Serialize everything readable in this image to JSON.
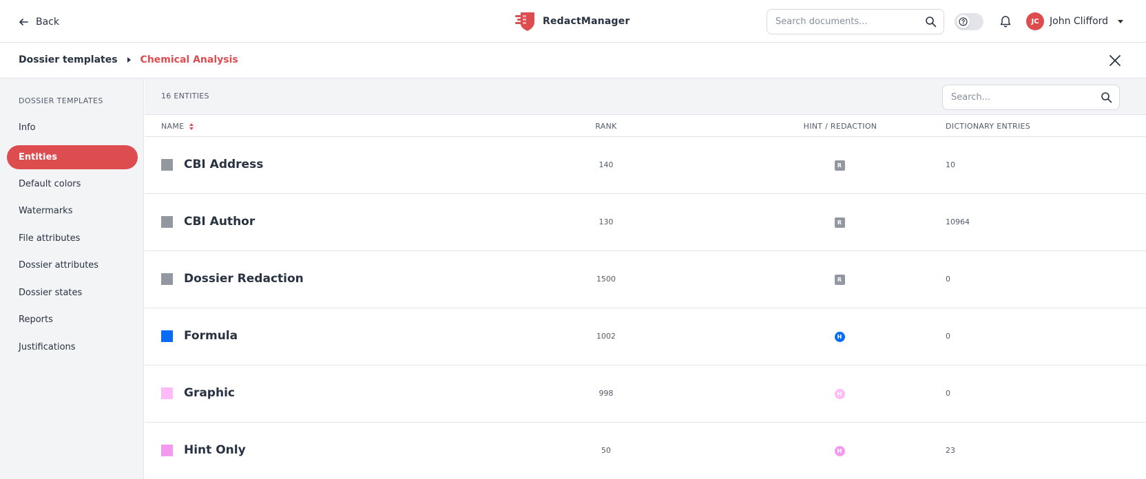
{
  "header": {
    "back_label": "Back",
    "brand_name": "RedactManager",
    "search_placeholder": "Search documents...",
    "user_initials": "JC",
    "user_name": "John Clifford",
    "brand_color": "#dd4d50"
  },
  "breadcrumb": {
    "root": "Dossier templates",
    "current": "Chemical Analysis"
  },
  "sidebar": {
    "heading": "DOSSIER TEMPLATES",
    "items": [
      {
        "label": "Info",
        "active": false
      },
      {
        "label": "Entities",
        "active": true
      },
      {
        "label": "Default colors",
        "active": false
      },
      {
        "label": "Watermarks",
        "active": false
      },
      {
        "label": "File attributes",
        "active": false
      },
      {
        "label": "Dossier attributes",
        "active": false
      },
      {
        "label": "Dossier states",
        "active": false
      },
      {
        "label": "Reports",
        "active": false
      },
      {
        "label": "Justifications",
        "active": false
      }
    ]
  },
  "list": {
    "count_label": "16 ENTITIES",
    "search_placeholder": "Search...",
    "columns": {
      "name": "NAME",
      "rank": "RANK",
      "hint_redaction": "HINT / REDACTION",
      "dictionary_entries": "DICTIONARY ENTRIES"
    },
    "rows": [
      {
        "name": "CBI Address",
        "color": "#9398a0",
        "rank": "140",
        "type": "R",
        "badge_color": "#9398a0",
        "entries": "10"
      },
      {
        "name": "CBI Author",
        "color": "#9398a0",
        "rank": "130",
        "type": "R",
        "badge_color": "#9398a0",
        "entries": "10964"
      },
      {
        "name": "Dossier Redaction",
        "color": "#9398a0",
        "rank": "1500",
        "type": "R",
        "badge_color": "#9398a0",
        "entries": "0"
      },
      {
        "name": "Formula",
        "color": "#0a6cf5",
        "rank": "1002",
        "type": "H",
        "badge_color": "#0a6cf5",
        "entries": "0"
      },
      {
        "name": "Graphic",
        "color": "#fdbbf7",
        "rank": "998",
        "type": "H",
        "badge_color": "#fdbbf7",
        "entries": "0"
      },
      {
        "name": "Hint Only",
        "color": "#f499f0",
        "rank": "50",
        "type": "H",
        "badge_color": "#f499f0",
        "entries": "23"
      }
    ]
  }
}
